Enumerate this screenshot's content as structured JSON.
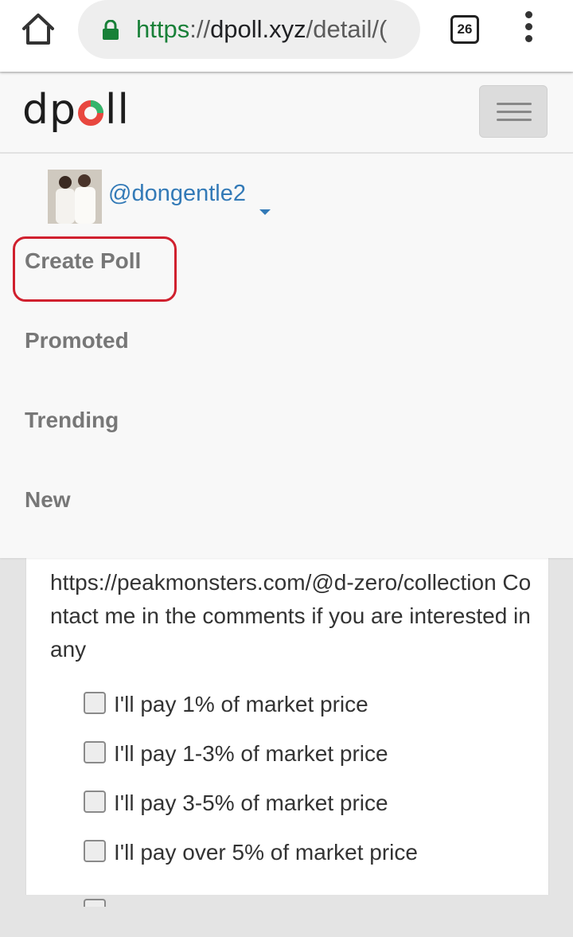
{
  "browser": {
    "url_scheme": "https",
    "url_separator": "://",
    "url_host": "dpoll.xyz",
    "url_path": "/detail/(",
    "tab_count": "26",
    "icons": {
      "home": "home-icon",
      "lock": "lock-icon",
      "tabs": "tab-switcher-icon",
      "menu": "more-vert-icon"
    },
    "colors": {
      "secure": "#188038"
    }
  },
  "site": {
    "logo_prefix": "dp",
    "logo_suffix": "ll",
    "logo_colors": {
      "ring_red": "#e8473f",
      "ring_green": "#33b56b",
      "text": "#1d1d1d"
    }
  },
  "menu": {
    "username": "@dongentle2",
    "items": [
      {
        "label": "Create Poll"
      },
      {
        "label": "Promoted"
      },
      {
        "label": "Trending"
      },
      {
        "label": "New"
      }
    ],
    "link_color": "#337ab7",
    "highlight_color": "#d0202e"
  },
  "poll": {
    "description": "https://peakmonsters.com/@d-zero/collection Contact me in the comments if you are interested in any",
    "options": [
      {
        "label": "I'll pay 1% of market price",
        "checked": false
      },
      {
        "label": "I'll pay 1-3% of market price",
        "checked": false
      },
      {
        "label": "I'll pay 3-5% of market price",
        "checked": false
      },
      {
        "label": "I'll pay over 5% of market price",
        "checked": false
      }
    ]
  }
}
